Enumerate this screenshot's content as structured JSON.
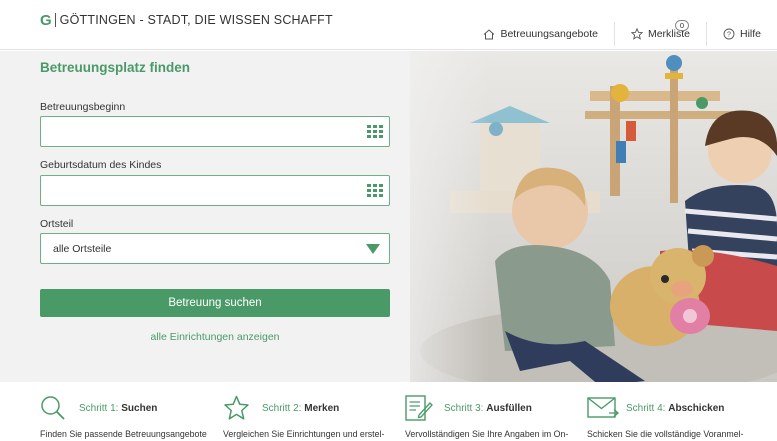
{
  "header": {
    "logo_mark": "G",
    "logo_text": "GÖTTINGEN - STADT, DIE WISSEN SCHAFFT",
    "nav": {
      "offers": "Betreuungsangebote",
      "watchlist": "Merkliste",
      "watchlist_count": "0",
      "help": "Hilfe"
    }
  },
  "form": {
    "title": "Betreuungsplatz finden",
    "start_label": "Betreuungsbeginn",
    "start_value": "",
    "birth_label": "Geburtsdatum des Kindes",
    "birth_value": "",
    "district_label": "Ortsteil",
    "district_selected": "alle Ortsteile",
    "search_button": "Betreuung suchen",
    "all_link": "alle Einrichtungen anzeigen"
  },
  "steps": [
    {
      "num": "Schritt 1:",
      "name": "Suchen",
      "desc": "Finden Sie passende Betreuungsangebote",
      "icon": "search-icon"
    },
    {
      "num": "Schritt 2:",
      "name": "Merken",
      "desc": "Vergleichen Sie Einrichtungen und erstel-",
      "icon": "star-icon"
    },
    {
      "num": "Schritt 3:",
      "name": "Ausfüllen",
      "desc": "Vervollständigen Sie Ihre Angaben im On-",
      "icon": "form-edit-icon"
    },
    {
      "num": "Schritt 4:",
      "name": "Abschicken",
      "desc": "Schicken Sie die vollständige Voranmel-",
      "icon": "mail-icon"
    }
  ],
  "colors": {
    "accent": "#4a9a68",
    "field_border": "#6fae86",
    "hero_bg": "#f2f2f2"
  }
}
